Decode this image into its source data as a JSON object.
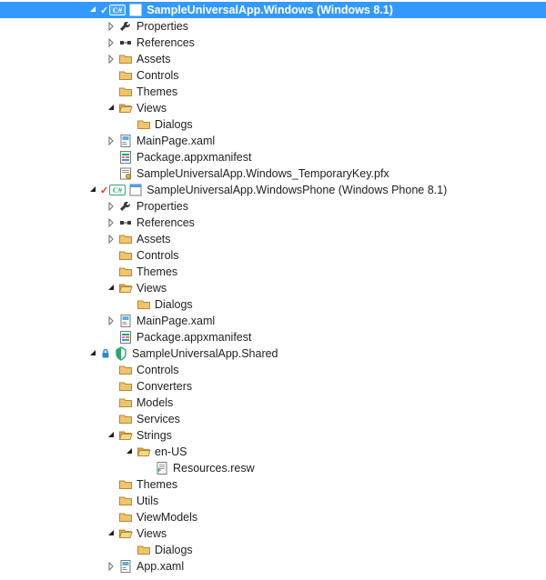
{
  "tree": [
    {
      "depth": 0,
      "expander": "expanded",
      "prefix": "startup-csharp",
      "icon": "project",
      "label": "SampleUniversalApp.Windows (Windows 8.1)",
      "selected": true,
      "interactable": true
    },
    {
      "depth": 1,
      "expander": "collapsed",
      "icon": "wrench",
      "label": "Properties",
      "interactable": true
    },
    {
      "depth": 1,
      "expander": "collapsed",
      "icon": "references",
      "label": "References",
      "interactable": true
    },
    {
      "depth": 1,
      "expander": "collapsed",
      "icon": "folder",
      "label": "Assets",
      "interactable": true
    },
    {
      "depth": 1,
      "expander": "none",
      "icon": "folder",
      "label": "Controls",
      "interactable": true
    },
    {
      "depth": 1,
      "expander": "none",
      "icon": "folder",
      "label": "Themes",
      "interactable": true
    },
    {
      "depth": 1,
      "expander": "expanded",
      "icon": "folder-open",
      "label": "Views",
      "interactable": true
    },
    {
      "depth": 2,
      "expander": "none",
      "icon": "folder",
      "label": "Dialogs",
      "interactable": true
    },
    {
      "depth": 1,
      "expander": "collapsed",
      "icon": "xaml",
      "label": "MainPage.xaml",
      "interactable": true
    },
    {
      "depth": 1,
      "expander": "none",
      "icon": "manifest",
      "label": "Package.appxmanifest",
      "interactable": true
    },
    {
      "depth": 1,
      "expander": "none",
      "icon": "pfx",
      "label": "SampleUniversalApp.Windows_TemporaryKey.pfx",
      "interactable": true
    },
    {
      "depth": 0,
      "expander": "expanded",
      "prefix": "startup-csharp",
      "icon": "project",
      "label": "SampleUniversalApp.WindowsPhone (Windows Phone 8.1)",
      "interactable": true
    },
    {
      "depth": 1,
      "expander": "collapsed",
      "icon": "wrench",
      "label": "Properties",
      "interactable": true
    },
    {
      "depth": 1,
      "expander": "collapsed",
      "icon": "references",
      "label": "References",
      "interactable": true
    },
    {
      "depth": 1,
      "expander": "collapsed",
      "icon": "folder",
      "label": "Assets",
      "interactable": true
    },
    {
      "depth": 1,
      "expander": "none",
      "icon": "folder",
      "label": "Controls",
      "interactable": true
    },
    {
      "depth": 1,
      "expander": "none",
      "icon": "folder",
      "label": "Themes",
      "interactable": true
    },
    {
      "depth": 1,
      "expander": "expanded",
      "icon": "folder-open",
      "label": "Views",
      "interactable": true
    },
    {
      "depth": 2,
      "expander": "none",
      "icon": "folder",
      "label": "Dialogs",
      "interactable": true
    },
    {
      "depth": 1,
      "expander": "collapsed",
      "icon": "xaml",
      "label": "MainPage.xaml",
      "interactable": true
    },
    {
      "depth": 1,
      "expander": "none",
      "icon": "manifest",
      "label": "Package.appxmanifest",
      "interactable": true
    },
    {
      "depth": 0,
      "expander": "expanded",
      "prefix": "locked",
      "icon": "shared",
      "label": "SampleUniversalApp.Shared",
      "interactable": true
    },
    {
      "depth": 1,
      "expander": "none",
      "icon": "folder",
      "label": "Controls",
      "interactable": true
    },
    {
      "depth": 1,
      "expander": "none",
      "icon": "folder",
      "label": "Converters",
      "interactable": true
    },
    {
      "depth": 1,
      "expander": "none",
      "icon": "folder",
      "label": "Models",
      "interactable": true
    },
    {
      "depth": 1,
      "expander": "none",
      "icon": "folder",
      "label": "Services",
      "interactable": true
    },
    {
      "depth": 1,
      "expander": "expanded",
      "icon": "folder-open",
      "label": "Strings",
      "interactable": true
    },
    {
      "depth": 2,
      "expander": "expanded",
      "icon": "folder-open",
      "label": "en-US",
      "interactable": true
    },
    {
      "depth": 3,
      "expander": "none",
      "icon": "resw-new",
      "label": "Resources.resw",
      "interactable": true
    },
    {
      "depth": 1,
      "expander": "none",
      "icon": "folder",
      "label": "Themes",
      "interactable": true
    },
    {
      "depth": 1,
      "expander": "none",
      "icon": "folder",
      "label": "Utils",
      "interactable": true
    },
    {
      "depth": 1,
      "expander": "none",
      "icon": "folder",
      "label": "ViewModels",
      "interactable": true
    },
    {
      "depth": 1,
      "expander": "expanded",
      "icon": "folder-open",
      "label": "Views",
      "interactable": true
    },
    {
      "depth": 2,
      "expander": "none",
      "icon": "folder",
      "label": "Dialogs",
      "interactable": true
    },
    {
      "depth": 1,
      "expander": "collapsed",
      "icon": "xaml",
      "label": "App.xaml",
      "interactable": true
    }
  ]
}
